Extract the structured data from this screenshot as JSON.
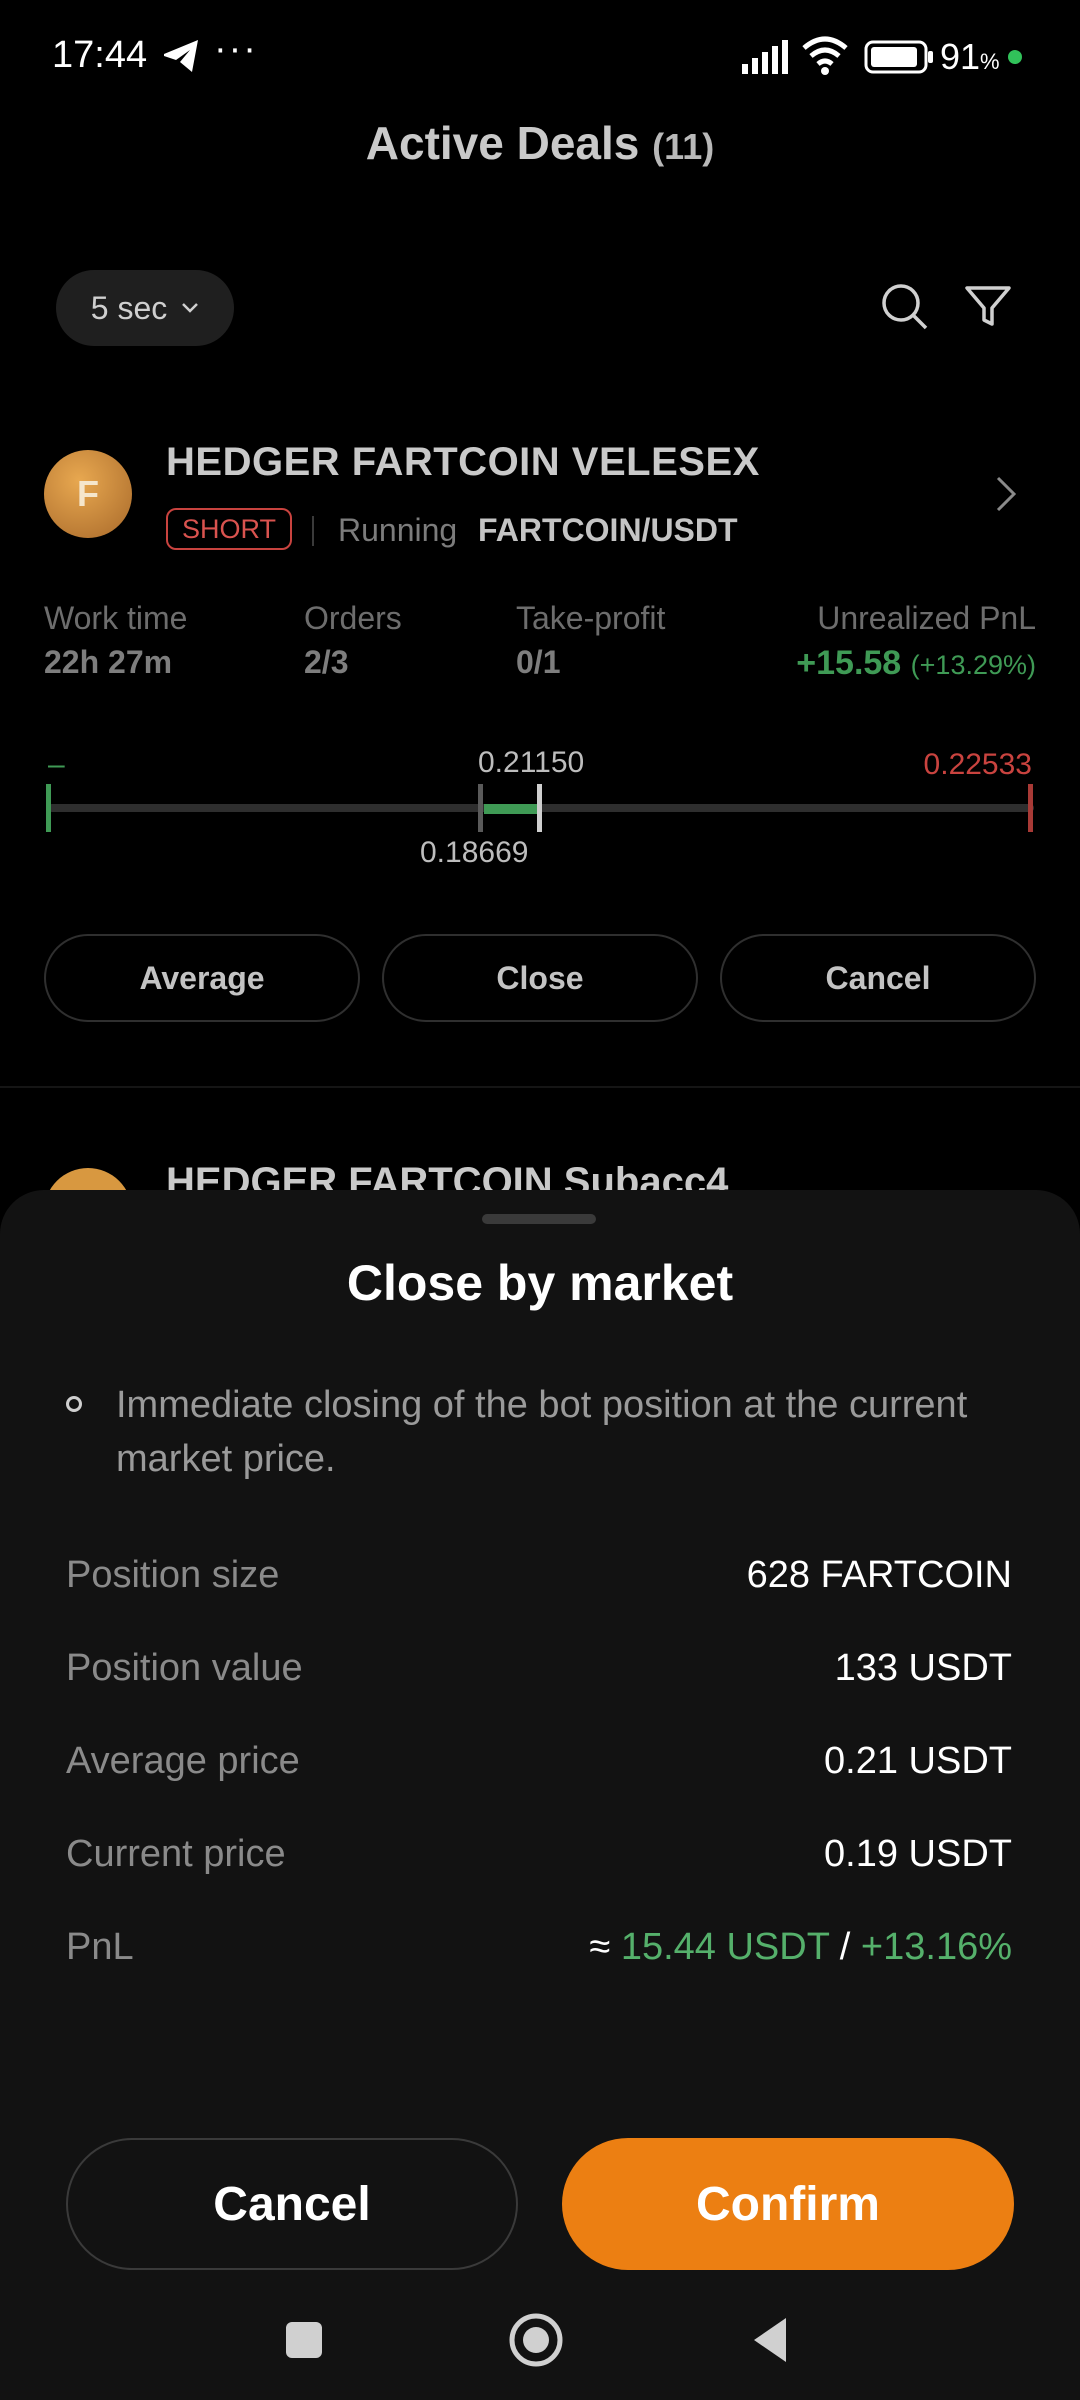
{
  "status_bar": {
    "time": "17:44",
    "more": "···",
    "battery_percent": "91",
    "battery_unit": "%"
  },
  "header": {
    "title": "Active Deals",
    "count": "(11)"
  },
  "toolbar": {
    "interval": "5 sec",
    "icons": [
      "search-icon",
      "filter-icon"
    ]
  },
  "deal": {
    "avatar_letter": "F",
    "name": "HEDGER FARTCOIN VELESEX",
    "side": "SHORT",
    "status": "Running",
    "pair": "FARTCOIN/USDT",
    "stats": {
      "work_time_label": "Work time",
      "work_time": "22h 27m",
      "orders_label": "Orders",
      "orders": "2/3",
      "take_profit_label": "Take-profit",
      "take_profit": "0/1",
      "pnl_label": "Unrealized PnL",
      "pnl": "+15.58",
      "pnl_pct": "(+13.29%)"
    },
    "range": {
      "left_label": "–",
      "average": "0.21150",
      "current": "0.18669",
      "stop": "0.22533"
    },
    "buttons": {
      "average": "Average",
      "close": "Close",
      "cancel": "Cancel"
    }
  },
  "next_deal": {
    "name": "HEDGER FARTCOIN Subacc4"
  },
  "sheet": {
    "title": "Close by market",
    "description": "Immediate closing of the bot position at the current market price.",
    "rows": [
      {
        "label": "Position size",
        "value": "628 FARTCOIN"
      },
      {
        "label": "Position value",
        "value": "133 USDT"
      },
      {
        "label": "Average price",
        "value": "0.21 USDT"
      },
      {
        "label": "Current price",
        "value": "0.19 USDT"
      }
    ],
    "pnl": {
      "label": "PnL",
      "approx": "≈",
      "usdt": "15.44 USDT",
      "separator": "/",
      "percent": "+13.16%"
    },
    "cancel": "Cancel",
    "confirm": "Confirm"
  },
  "colors": {
    "accent": "#ec7f12",
    "positive": "#55b06b",
    "negative": "#d9534f",
    "sheet_bg": "#121212"
  }
}
